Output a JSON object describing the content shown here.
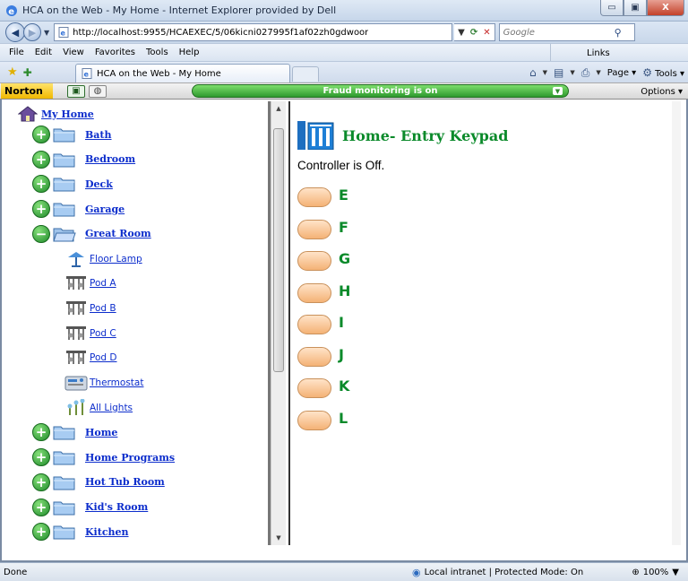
{
  "window": {
    "title": "HCA on the Web - My Home - Internet Explorer provided by Dell",
    "minimize": "▭",
    "maximize": "▣",
    "close": "X"
  },
  "address": {
    "url": "http://localhost:9955/HCAEXEC/5/06kicni027995f1af02zh0gdwoor",
    "search_placeholder": "Google"
  },
  "menu": {
    "items": [
      "File",
      "Edit",
      "View",
      "Favorites",
      "Tools",
      "Help"
    ],
    "links": "Links"
  },
  "tabs": {
    "active_label": "HCA on the Web - My Home",
    "page_label": "Page",
    "tools_label": "Tools"
  },
  "norton": {
    "brand": "Norton",
    "fraud_text": "Fraud monitoring is on",
    "options_label": "Options"
  },
  "tree": {
    "root": "My Home",
    "items": [
      {
        "label": "Bath",
        "type": "folder",
        "expanded": false
      },
      {
        "label": "Bedroom",
        "type": "folder",
        "expanded": false
      },
      {
        "label": "Deck",
        "type": "folder",
        "expanded": false
      },
      {
        "label": "Garage",
        "type": "folder",
        "expanded": false
      },
      {
        "label": "Great Room",
        "type": "folder",
        "expanded": true
      },
      {
        "label": "Floor Lamp",
        "type": "lamp"
      },
      {
        "label": "Pod A",
        "type": "pod"
      },
      {
        "label": "Pod B",
        "type": "pod"
      },
      {
        "label": "Pod C",
        "type": "pod"
      },
      {
        "label": "Pod D",
        "type": "pod"
      },
      {
        "label": "Thermostat",
        "type": "thermostat"
      },
      {
        "label": "All Lights",
        "type": "lights"
      },
      {
        "label": "Home",
        "type": "folder",
        "expanded": false
      },
      {
        "label": "Home Programs",
        "type": "folder",
        "expanded": false
      },
      {
        "label": "Hot Tub Room",
        "type": "folder",
        "expanded": false
      },
      {
        "label": "Kid's Room",
        "type": "folder",
        "expanded": false
      },
      {
        "label": "Kitchen",
        "type": "folder",
        "expanded": false
      }
    ]
  },
  "keypad": {
    "title": "Home- Entry Keypad",
    "status": "Controller is Off.",
    "keys": [
      "E",
      "F",
      "G",
      "H",
      "I",
      "J",
      "K",
      "L"
    ]
  },
  "status": {
    "text": "Done",
    "zone": "Local intranet | Protected Mode: On",
    "zoom": "100%"
  }
}
